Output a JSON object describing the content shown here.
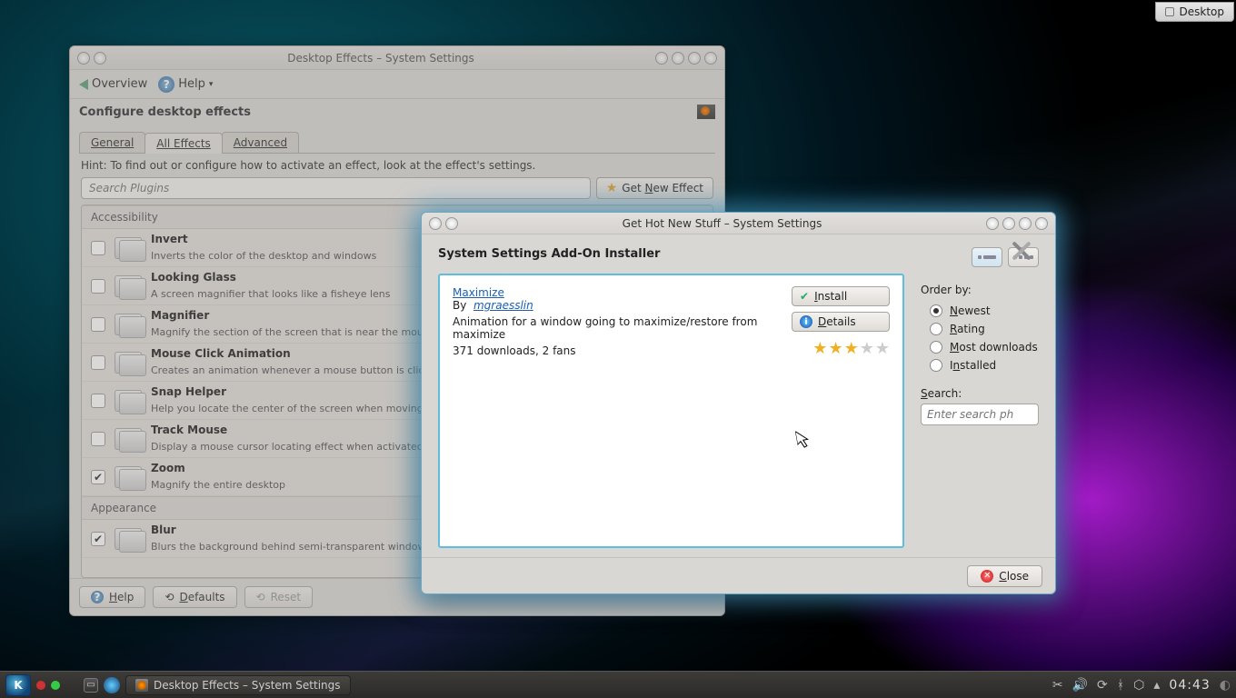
{
  "desktop_toggle": "Desktop",
  "win1": {
    "title": "Desktop Effects – System Settings",
    "overview": "Overview",
    "help": "Help",
    "header": "Configure desktop effects",
    "tabs": {
      "general": "General",
      "all_effects": "All Effects",
      "advanced": "Advanced"
    },
    "hint": "Hint: To find out or configure how to activate an effect, look at the effect's settings.",
    "search_placeholder": "Search Plugins",
    "get_new": "Get New Effect",
    "groups": {
      "accessibility": "Accessibility",
      "appearance": "Appearance"
    },
    "effects": [
      {
        "checked": false,
        "name": "Invert",
        "desc": "Inverts the color of the desktop and windows"
      },
      {
        "checked": false,
        "name": "Looking Glass",
        "desc": "A screen magnifier that looks like a fisheye lens"
      },
      {
        "checked": false,
        "name": "Magnifier",
        "desc": "Magnify the section of the screen that is near the mous"
      },
      {
        "checked": false,
        "name": "Mouse Click Animation",
        "desc": "Creates an animation whenever a mouse button is click"
      },
      {
        "checked": false,
        "name": "Snap Helper",
        "desc": "Help you locate the center of the screen when moving a"
      },
      {
        "checked": false,
        "name": "Track Mouse",
        "desc": "Display a mouse cursor locating effect when activated"
      },
      {
        "checked": true,
        "name": "Zoom",
        "desc": "Magnify the entire desktop"
      }
    ],
    "blur": {
      "checked": true,
      "name": "Blur",
      "desc": "Blurs the background behind semi-transparent window"
    },
    "footer": {
      "help": "Help",
      "defaults": "Defaults",
      "reset": "Reset"
    }
  },
  "win2": {
    "title": "Get Hot New Stuff – System Settings",
    "header": "System Settings Add-On Installer",
    "item": {
      "title": "Maximize",
      "by": "By",
      "author": "mgraesslin",
      "desc": "Animation for a window going to maximize/restore from maximize",
      "stats": "371 downloads, 2 fans"
    },
    "install": "Install",
    "details": "Details",
    "order_by": "Order by:",
    "sort": {
      "newest": "Newest",
      "rating": "Rating",
      "most": "Most downloads",
      "installed": "Installed"
    },
    "search_label": "Search:",
    "search_placeholder": "Enter search ph",
    "close": "Close"
  },
  "panel": {
    "task": "Desktop Effects – System Settings",
    "time": "04:43"
  }
}
